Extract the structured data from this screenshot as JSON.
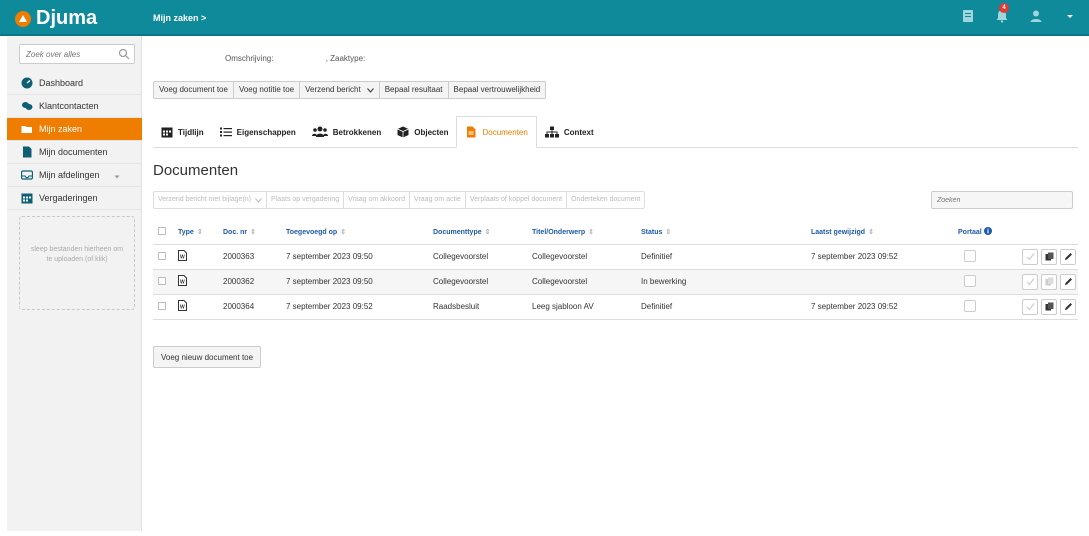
{
  "app": {
    "brand": "Djuma",
    "breadcrumb": "Mijn zaken >",
    "notification_count": "4"
  },
  "sidebar": {
    "search_placeholder": "Zoek over alles",
    "items": [
      {
        "label": "Dashboard",
        "icon": "dashboard-icon"
      },
      {
        "label": "Klantcontacten",
        "icon": "contacts-icon"
      },
      {
        "label": "Mijn zaken",
        "icon": "folder-open-icon",
        "active": true
      },
      {
        "label": "Mijn documenten",
        "icon": "document-icon"
      },
      {
        "label": "Mijn afdelingen",
        "icon": "inbox-icon"
      },
      {
        "label": "Vergaderingen",
        "icon": "calendar-icon"
      }
    ],
    "dropzone": "sleep bestanden hierheen om te uploaden (of klik)"
  },
  "meta": {
    "omschrijving": "Omschrijving:",
    "zaaktype": ", Zaaktype:"
  },
  "actions": [
    "Voeg document toe",
    "Voeg notitie toe",
    "Verzend bericht",
    "Bepaal resultaat",
    "Bepaal vertrouwelijkheid"
  ],
  "tabs": [
    {
      "label": "Tijdlijn",
      "icon": "calendar-icon"
    },
    {
      "label": "Eigenschappen",
      "icon": "list-icon"
    },
    {
      "label": "Betrokkenen",
      "icon": "users-icon"
    },
    {
      "label": "Objecten",
      "icon": "cube-icon"
    },
    {
      "label": "Documenten",
      "icon": "file-icon",
      "active": true
    },
    {
      "label": "Context",
      "icon": "sitemap-icon"
    }
  ],
  "heading": "Documenten",
  "doc_actions": [
    "Verzend bericht met bijlage(n)",
    "Plaats op vergadering",
    "Vraag om akkoord",
    "Vraag om actie",
    "Verplaats of koppel document",
    "Onderteken document"
  ],
  "table_search_placeholder": "Zoeken",
  "table": {
    "headers": [
      "Type",
      "Doc. nr",
      "Toegevoegd op",
      "Documenttype",
      "Titel/Onderwerp",
      "Status",
      "Laatst gewijzigd",
      "Portaal"
    ],
    "rows": [
      {
        "docnr": "2000363",
        "added": "7 september 2023 09:50",
        "doctype": "Collegevoorstel",
        "title": "Collegevoorstel",
        "status": "Definitief",
        "modified": "7 september 2023 09:52"
      },
      {
        "docnr": "2000362",
        "added": "7 september 2023 09:50",
        "doctype": "Collegevoorstel",
        "title": "Collegevoorstel",
        "status": "In bewerking",
        "modified": ""
      },
      {
        "docnr": "2000364",
        "added": "7 september 2023 09:52",
        "doctype": "Raadsbesluit",
        "title": "Leeg sjabloon AV",
        "status": "Definitief",
        "modified": "7 september 2023 09:52"
      }
    ]
  },
  "add_button": "Voeg nieuw document toe",
  "colors": {
    "topbar": "#0e8a9b",
    "accent": "#ef7d00",
    "link": "#1f5aa8"
  }
}
